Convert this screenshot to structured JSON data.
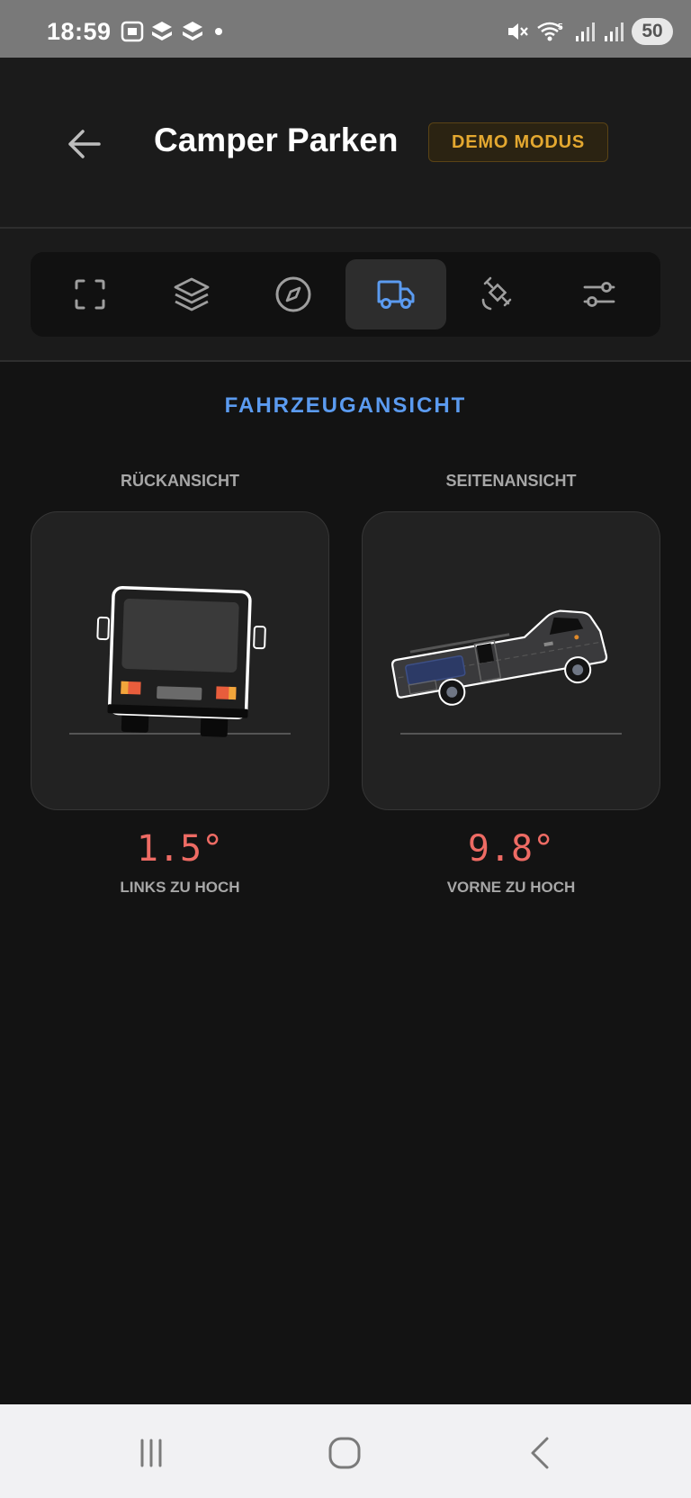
{
  "status_bar": {
    "time": "18:59",
    "battery": "50",
    "icons": [
      "screenshot-icon",
      "app-icon",
      "app-icon",
      "dot-icon",
      "mute-icon",
      "wifi-icon",
      "signal-icon",
      "signal-icon",
      "battery-icon"
    ]
  },
  "header": {
    "title": "Camper Parken",
    "badge": "DEMO MODUS",
    "back_icon": "arrow-left-icon"
  },
  "tabs": [
    {
      "icon": "scan-icon",
      "active": false
    },
    {
      "icon": "layers-icon",
      "active": false
    },
    {
      "icon": "compass-icon",
      "active": false
    },
    {
      "icon": "truck-icon",
      "active": true
    },
    {
      "icon": "satellite-icon",
      "active": false
    },
    {
      "icon": "sliders-icon",
      "active": false
    }
  ],
  "section": {
    "title": "FAHRZEUGANSICHT"
  },
  "rear_view": {
    "label": "RÜCKANSICHT",
    "angle": "1.5°",
    "description": "LINKS ZU HOCH"
  },
  "side_view": {
    "label": "SEITENANSICHT",
    "angle": "9.8°",
    "description": "VORNE ZU HOCH"
  },
  "nav_bar": {
    "icons": [
      "recent-apps-icon",
      "home-icon",
      "back-icon"
    ]
  },
  "colors": {
    "accent_blue": "#5b9bf0",
    "badge_gold": "#e4a830",
    "angle_red": "#ee6b64",
    "background": "#131313"
  }
}
